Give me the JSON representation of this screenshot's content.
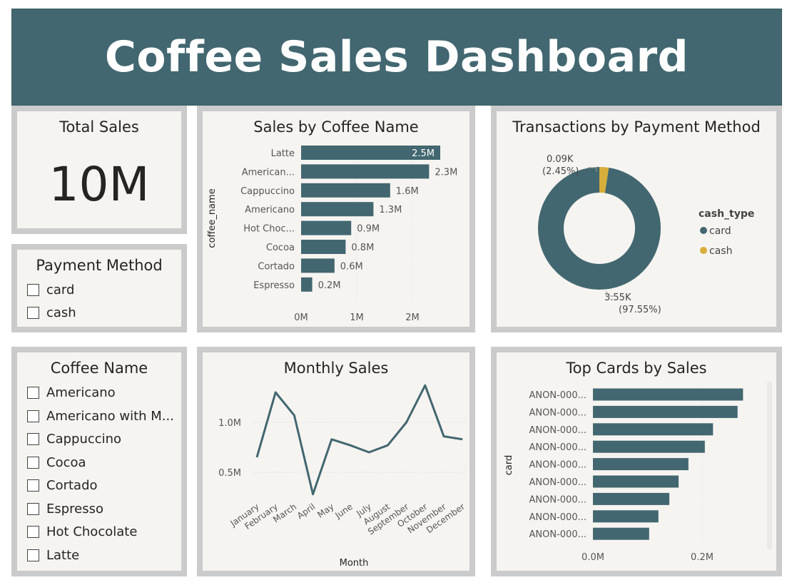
{
  "header": {
    "title": "Coffee Sales Dashboard",
    "bg_color": "#426770"
  },
  "colors": {
    "bar": "#426770",
    "card_type": "#426770",
    "cash_type": "#d8ae3a",
    "panel_bg": "#f6f4f1",
    "panel_border": "#cbcbcb"
  },
  "total_sales": {
    "title": "Total Sales",
    "value": "10M"
  },
  "payment_slicer": {
    "title": "Payment Method",
    "items": [
      "card",
      "cash"
    ]
  },
  "coffee_slicer": {
    "title": "Coffee Name",
    "items": [
      "Americano",
      "Americano with M...",
      "Cappuccino",
      "Cocoa",
      "Cortado",
      "Espresso",
      "Hot Chocolate",
      "Latte"
    ]
  },
  "sales_by_coffee": {
    "title": "Sales by Coffee Name",
    "ylabel": "coffee_name",
    "x_ticks": [
      "0M",
      "1M",
      "2M"
    ]
  },
  "payment_donut": {
    "title": "Transactions by Payment Method",
    "legend_title": "cash_type",
    "legend": [
      "card",
      "cash"
    ],
    "cash_value": "0.09K",
    "cash_pct": "(2.45%)",
    "card_value": "3.55K",
    "card_pct": "(97.55%)"
  },
  "monthly_sales": {
    "title": "Monthly Sales",
    "xlabel": "Month",
    "y_ticks": [
      "1.0M",
      "0.5M"
    ]
  },
  "top_cards": {
    "title": "Top Cards by Sales",
    "ylabel": "card",
    "x_ticks": [
      "0.0M",
      "0.2M"
    ]
  },
  "chart_data": [
    {
      "type": "bar",
      "orientation": "horizontal",
      "title": "Sales by Coffee Name",
      "ylabel": "coffee_name",
      "xlim": [
        0,
        3.0
      ],
      "categories": [
        "Latte",
        "American...",
        "Cappuccino",
        "Americano",
        "Hot Choc...",
        "Cocoa",
        "Cortado",
        "Espresso"
      ],
      "values": [
        2.5,
        2.3,
        1.6,
        1.3,
        0.9,
        0.8,
        0.6,
        0.2
      ],
      "labels": [
        "2.5M",
        "2.3M",
        "1.6M",
        "1.3M",
        "0.9M",
        "0.8M",
        "0.6M",
        "0.2M"
      ]
    },
    {
      "type": "pie",
      "title": "Transactions by Payment Method",
      "categories": [
        "card",
        "cash"
      ],
      "values": [
        3.55,
        0.09
      ],
      "percent": [
        97.55,
        2.45
      ]
    },
    {
      "type": "line",
      "title": "Monthly Sales",
      "xlabel": "Month",
      "categories": [
        "January",
        "February",
        "March",
        "April",
        "May",
        "June",
        "July",
        "August",
        "September",
        "October",
        "November",
        "December"
      ],
      "values": [
        0.65,
        1.3,
        1.07,
        0.28,
        0.83,
        0.77,
        0.7,
        0.77,
        1.0,
        1.37,
        0.86,
        0.83
      ],
      "ylim": [
        0.25,
        1.4
      ]
    },
    {
      "type": "bar",
      "orientation": "horizontal",
      "title": "Top Cards by Sales",
      "ylabel": "card",
      "xlim": [
        0,
        0.3
      ],
      "categories": [
        "ANON-000...",
        "ANON-000...",
        "ANON-000...",
        "ANON-000...",
        "ANON-000...",
        "ANON-000...",
        "ANON-000...",
        "ANON-000...",
        "ANON-000..."
      ],
      "values": [
        0.275,
        0.265,
        0.22,
        0.205,
        0.175,
        0.157,
        0.14,
        0.12,
        0.103
      ]
    }
  ]
}
